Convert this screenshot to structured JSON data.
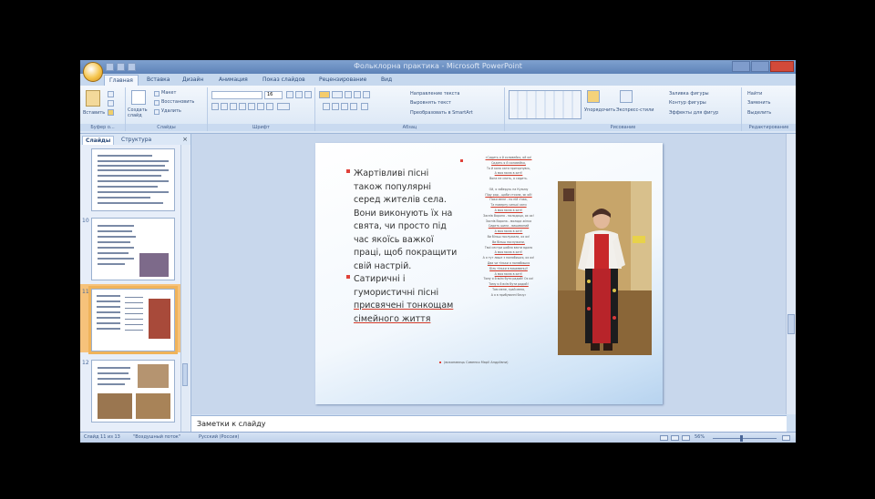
{
  "window": {
    "title": "Фольклорна практика - Microsoft PowerPoint"
  },
  "ribbon_tabs": [
    "Главная",
    "Вставка",
    "Дизайн",
    "Анимация",
    "Показ слайдов",
    "Рецензирование",
    "Вид"
  ],
  "ribbon": {
    "clipboard": {
      "paste": "Вставить",
      "label": "Буфер о..."
    },
    "slides": {
      "new_slide": "Создать слайд",
      "layout": "Макет",
      "reset": "Восстановить",
      "delete": "Удалить",
      "label": "Слайды"
    },
    "font": {
      "label": "Шрифт",
      "size": "16"
    },
    "paragraph": {
      "label": "Абзац",
      "direction": "Направление текста",
      "align": "Выровнять текст",
      "smartart": "Преобразовать в SmartArt"
    },
    "drawing": {
      "arrange": "Упорядочить",
      "styles": "Экспресс-стили",
      "fill": "Заливка фигуры",
      "outline": "Контур фигуры",
      "effects": "Эффекты для фигур",
      "label": "Рисование"
    },
    "editing": {
      "find": "Найти",
      "replace": "Заменить",
      "select": "Выделить",
      "label": "Редактирование"
    }
  },
  "left_panel": {
    "tab_slides": "Слайды",
    "tab_structure": "Структура",
    "slide_numbers": [
      "",
      "10",
      "11",
      "12"
    ]
  },
  "slide": {
    "bullets": [
      "Жартівливі пісні також популярні серед жителів села. Вони виконують їх на свята, чи просто під час якоїсь важкої праці, щоб покращити свій настрій.",
      "Сатиричні і гумористичні пісні "
    ],
    "bullet2_underlined": "присвячені тонкощам сімейного життя",
    "song_lines": [
      {
        "text": "«Сидить я й соловейко, ой ох!",
        "u": true
      },
      {
        "text": "Сидить я й соловейко,",
        "u": true
      },
      {
        "text": "Та й коло хати пригорнувсь,",
        "u": false
      },
      {
        "text": "А моя мила в хаті!",
        "u": true
      },
      {
        "text": "Вона не спить, а сидить.",
        "u": false
      },
      {
        "text": "",
        "u": false
      },
      {
        "text": "Ой, я заберусь на Кузьму",
        "u": false
      },
      {
        "text": "Піду ряд - щоби стояла, як ой!",
        "u": true
      },
      {
        "text": "Поки мене - по ній з'ява,",
        "u": false
      },
      {
        "text": "Та поверну синьої хати",
        "u": true
      },
      {
        "text": "А моя мила в хаті!",
        "u": true
      },
      {
        "text": "Заспів Ворона - молодиця, ох ох!",
        "u": false
      },
      {
        "text": "Заспів Ворона - молода жінка",
        "u": false
      },
      {
        "text": "Сидить шила - вишиваний",
        "u": true
      },
      {
        "text": "А моя мила в хаті!",
        "u": true
      },
      {
        "text": "Ви більш послужили, ох ох!",
        "u": false
      },
      {
        "text": "Ви більш послужили,",
        "u": true
      },
      {
        "text": "Твої сестри шабля взяти вдало",
        "u": false
      },
      {
        "text": "А моя мила в хаті!",
        "u": true
      },
      {
        "text": "А я тут лише з полюбишся, ох ох!",
        "u": false
      },
      {
        "text": "Два чи тільки я полюбишся",
        "u": true
      },
      {
        "text": "Біль тільки в вишиванці!",
        "u": true
      },
      {
        "text": "А моя мила в хаті!",
        "u": true
      },
      {
        "text": "Тому я й всім бути радий! Ох ох!",
        "u": false
      },
      {
        "text": "Тому я й всім бути радий!",
        "u": true
      },
      {
        "text": "Там мене, грай меня,",
        "u": false
      },
      {
        "text": "А я в прибуванні бачу»",
        "u": false
      }
    ],
    "caption": "(виконавець Сивенко Марії Андріївни)"
  },
  "notes_placeholder": "Заметки к слайду",
  "status_bar": {
    "slide_info": "Слайд 11 из 13",
    "theme": "\"Воздушный поток\"",
    "language": "Русский (Россия)",
    "zoom": "56%"
  },
  "colors": {
    "accent": "#e0423a",
    "ribbon": "#dfe9f5",
    "selection": "#f6c27b"
  }
}
